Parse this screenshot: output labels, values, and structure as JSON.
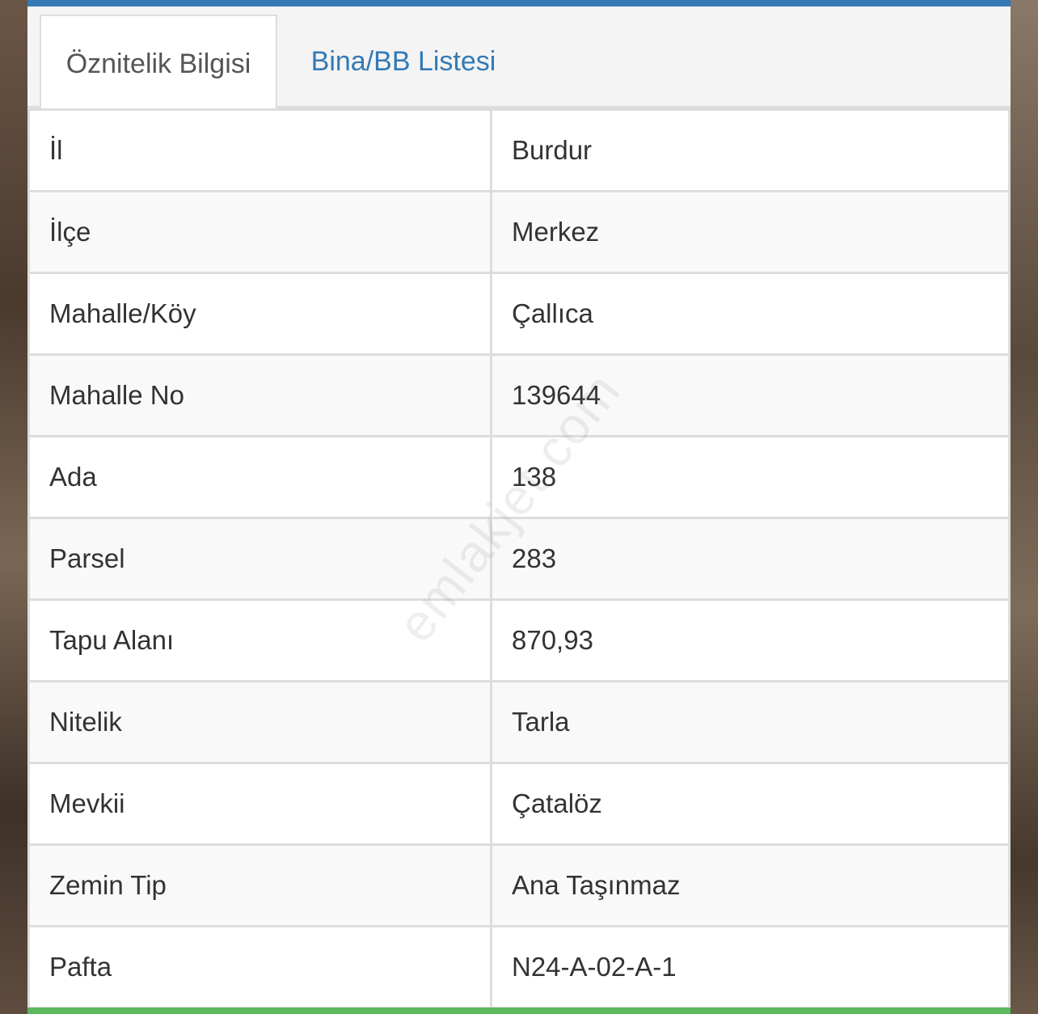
{
  "tabs": [
    {
      "label": "Öznitelik Bilgisi",
      "active": true
    },
    {
      "label": "Bina/BB Listesi",
      "active": false
    }
  ],
  "rows": [
    {
      "key": "İl",
      "value": "Burdur"
    },
    {
      "key": "İlçe",
      "value": "Merkez"
    },
    {
      "key": "Mahalle/Köy",
      "value": "Çallıca"
    },
    {
      "key": "Mahalle No",
      "value": "139644"
    },
    {
      "key": "Ada",
      "value": "138"
    },
    {
      "key": "Parsel",
      "value": "283"
    },
    {
      "key": "Tapu Alanı",
      "value": "870,93"
    },
    {
      "key": "Nitelik",
      "value": "Tarla"
    },
    {
      "key": "Mevkii",
      "value": "Çatalöz"
    },
    {
      "key": "Zemin Tip",
      "value": "Ana Taşınmaz"
    },
    {
      "key": "Pafta",
      "value": "N24-A-02-A-1"
    }
  ],
  "watermark": "emlakjet.com",
  "colors": {
    "accent_top": "#337ab7",
    "accent_bottom": "#5cb85c",
    "tab_link": "#337ab7"
  }
}
